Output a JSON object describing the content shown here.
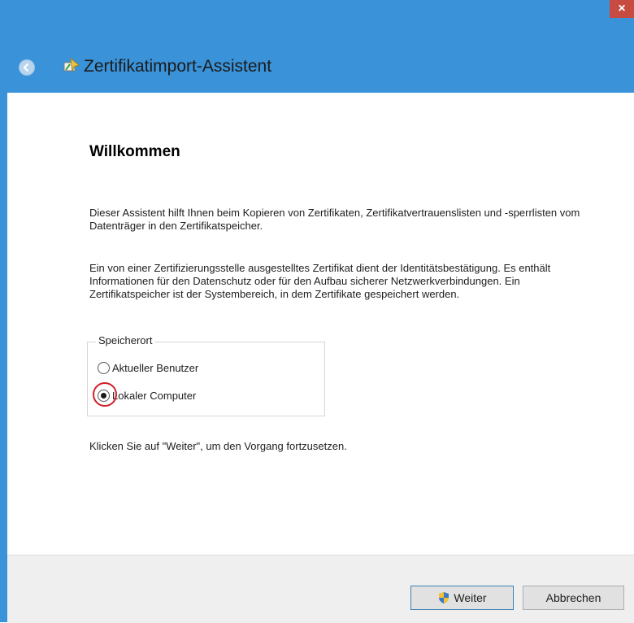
{
  "window": {
    "title": "Zertifikatimport-Assistent",
    "close_label": "×",
    "accent_color": "#3a92d8"
  },
  "page": {
    "heading": "Willkommen",
    "paragraph1": "Dieser Assistent hilft Ihnen beim Kopieren von Zertifikaten, Zertifikatvertrauenslisten und -sperrlisten vom Datenträger in den Zertifikatspeicher.",
    "paragraph2": "Ein von einer Zertifizierungsstelle ausgestelltes Zertifikat dient der Identitätsbestätigung. Es enthält Informationen für den Datenschutz oder für den Aufbau sicherer Netzwerkverbindungen. Ein Zertifikatspeicher ist der Systembereich, in dem Zertifikate gespeichert werden.",
    "instruction": "Klicken Sie auf \"Weiter\", um den Vorgang fortzusetzen."
  },
  "storage": {
    "group_label": "Speicherort",
    "options": [
      {
        "label": "Aktueller Benutzer",
        "checked": false
      },
      {
        "label": "Lokaler Computer",
        "checked": true
      }
    ]
  },
  "buttons": {
    "next_label": "Weiter",
    "cancel_label": "Abbrechen"
  }
}
